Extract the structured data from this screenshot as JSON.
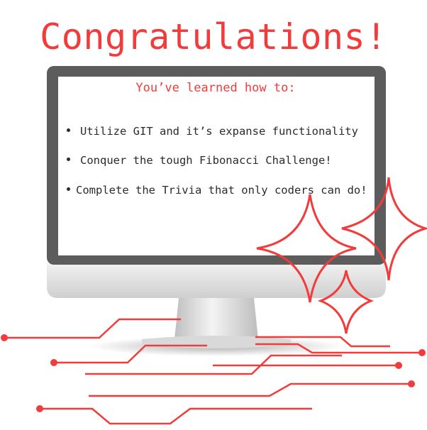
{
  "title": "Congratulations!",
  "screen": {
    "subtitle": "You’ve learned how to:",
    "items": [
      {
        "label": "Utilize GIT and it’s expanse functionality"
      },
      {
        "label": "Conquer the tough Fibonacci Challenge!"
      },
      {
        "label": "Complete the Trivia that only coders can do!"
      }
    ]
  },
  "colors": {
    "accent": "#f23b3b",
    "bezel": "#5c5c5c",
    "text": "#2b2b2b"
  },
  "icons": [
    "monitor-illustration",
    "sparkle-icon",
    "circuit-lines"
  ]
}
